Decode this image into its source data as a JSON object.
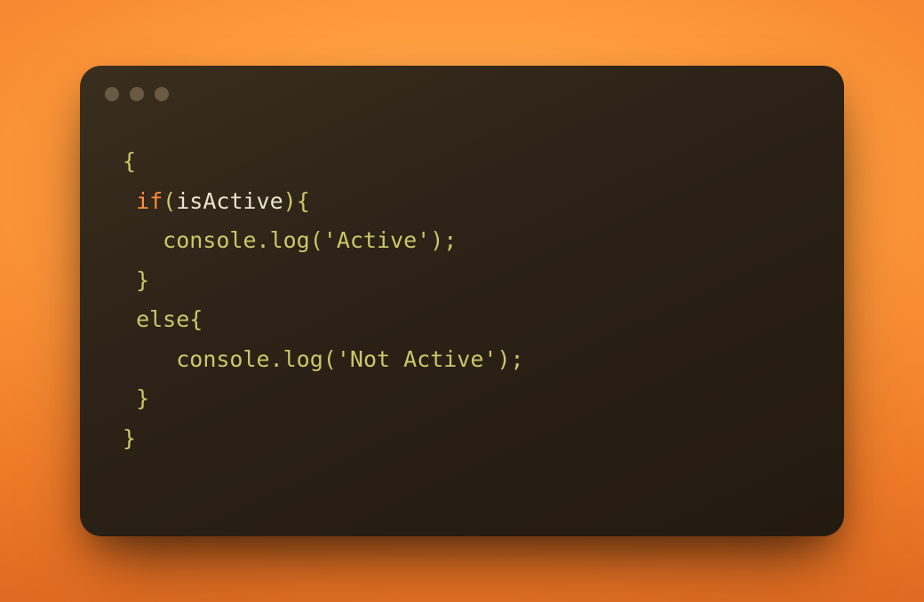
{
  "window": {
    "dot_color": "#6a5a43"
  },
  "code": {
    "tokens": {
      "brace_open": "{",
      "brace_close": "}",
      "if_kw": "if",
      "paren_open": "(",
      "isActive": "isActive",
      "paren_close_brace": "){",
      "console_log_open": "console.log(",
      "str_active": "'Active'",
      "close_stmt": ");",
      "else_kw_brace": "else{",
      "str_not_active": "'Not Active'"
    },
    "indent": {
      "i0": "",
      "i1": " ",
      "i2": "   ",
      "i2b": "    "
    }
  }
}
